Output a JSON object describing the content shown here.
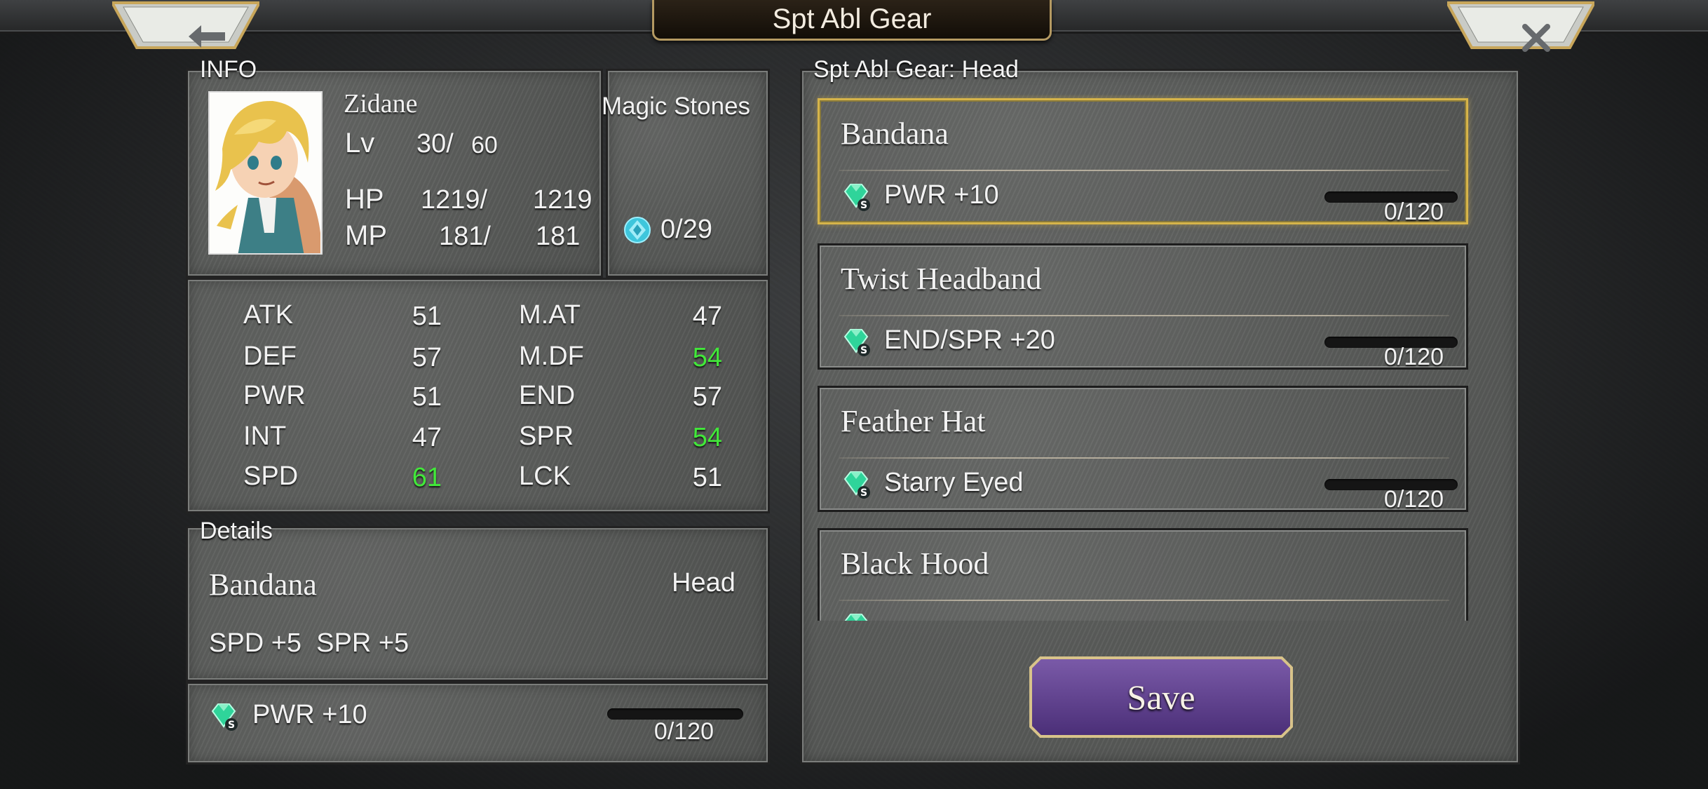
{
  "header": {
    "title": "Spt Abl Gear",
    "back_icon": "back-arrow-icon",
    "close_icon": "close-icon"
  },
  "info": {
    "label": "INFO",
    "name": "Zidane",
    "lv_label": "Lv",
    "lv_value": "30/",
    "lv_max": "60",
    "hp_label": "HP",
    "hp_value": "1219/",
    "hp_max": "1219",
    "mp_label": "MP",
    "mp_value": "181/",
    "mp_max": "181"
  },
  "magic_stones": {
    "label": "Magic Stones",
    "count": "0/29"
  },
  "stats": [
    {
      "label": "ATK",
      "value": "51",
      "label2": "M.AT",
      "value2": "47"
    },
    {
      "label": "DEF",
      "value": "57",
      "label2": "M.DF",
      "value2": "54"
    },
    {
      "label": "PWR",
      "value": "51",
      "label2": "END",
      "value2": "57"
    },
    {
      "label": "INT",
      "value": "47",
      "label2": "SPR",
      "value2": "54"
    },
    {
      "label": "SPD",
      "value": "61",
      "label2": "LCK",
      "value2": "51"
    }
  ],
  "details": {
    "label": "Details",
    "item_name": "Bandana",
    "slot": "Head",
    "bonus": "SPD +5  SPR +5",
    "ability": "PWR +10",
    "progress": "0/120",
    "progress_fraction": 0
  },
  "gear_list": {
    "label": "Spt Abl Gear: Head",
    "items": [
      {
        "name": "Bandana",
        "ability": "PWR +10",
        "progress": "0/120",
        "fraction": 0,
        "selected": true
      },
      {
        "name": "Twist Headband",
        "ability": "END/SPR +20",
        "progress": "0/120",
        "fraction": 0,
        "selected": false
      },
      {
        "name": "Feather Hat",
        "ability": "Starry Eyed",
        "progress": "0/120",
        "fraction": 0,
        "selected": false
      },
      {
        "name": "Black Hood",
        "ability": "",
        "progress": "",
        "fraction": 0,
        "selected": false
      }
    ]
  },
  "save_button": {
    "label": "Save"
  },
  "colors": {
    "highlight_stat": "#42e83a",
    "selected_border": "#d6b44a",
    "save_button": "#5e3f8f"
  }
}
